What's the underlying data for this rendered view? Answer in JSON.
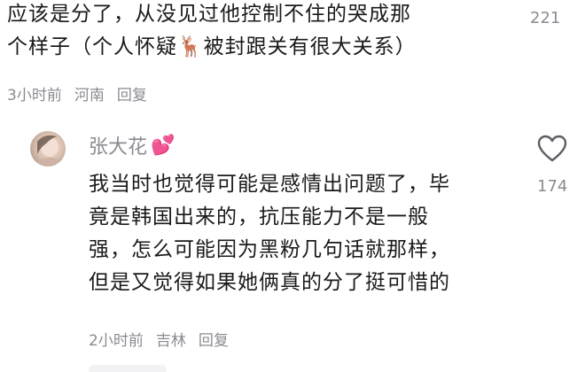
{
  "comment1": {
    "lines": [
      "应该是分了，从没见过他控制不住的哭成那",
      "个样子（个人怀疑🦌被封跟关有很大关系）"
    ],
    "likes": "221",
    "meta": {
      "time": "3小时前",
      "location": "河南",
      "reply": "回复"
    }
  },
  "comment2": {
    "username": "张大花",
    "username_emoji": "💕",
    "lines": [
      "我当时也觉得可能是感情出问题了，毕",
      "竟是韩国出来的，抗压能力不是一般",
      "强，怎么可能因为黑粉几句话就那样，",
      "但是又觉得如果她俩真的分了挺可惜的"
    ],
    "likes": "174",
    "meta": {
      "time": "2小时前",
      "location": "吉林",
      "reply": "回复"
    }
  },
  "icons": {
    "like": "heart-outline-icon",
    "avatar": "user-avatar"
  },
  "colors": {
    "text": "#1a1a1a",
    "meta": "#8a8b91",
    "background": "#ffffff"
  }
}
